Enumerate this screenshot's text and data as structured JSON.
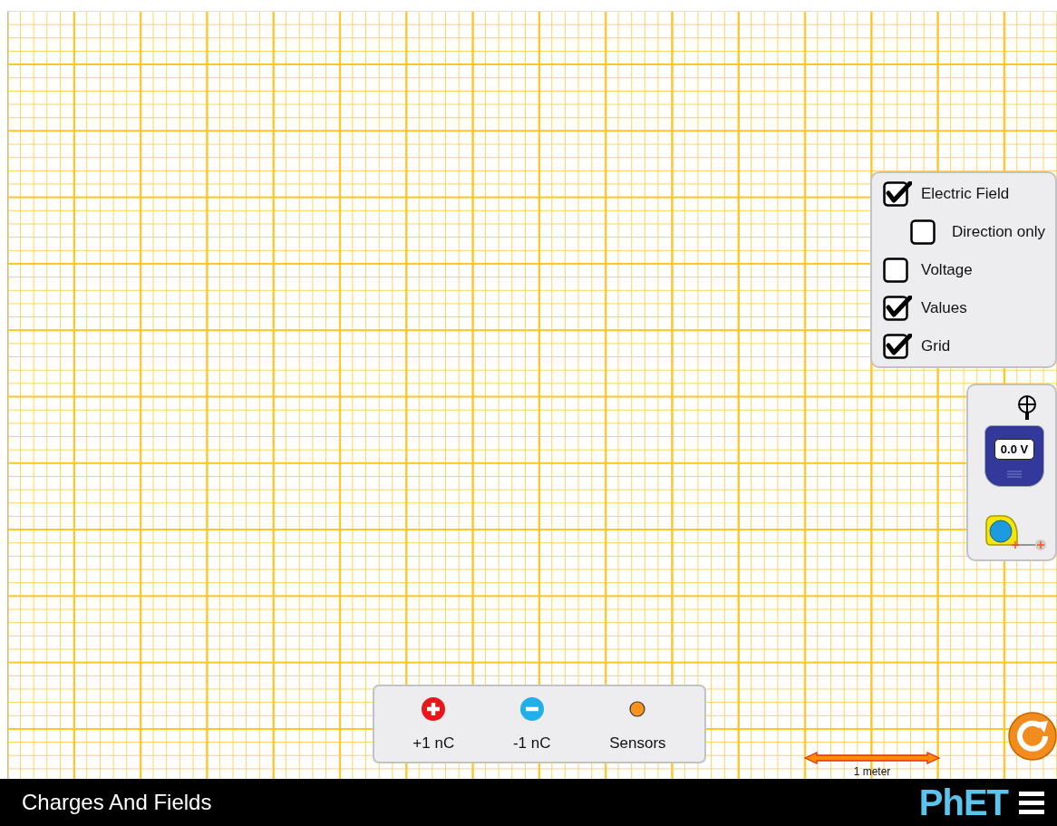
{
  "controls": [
    {
      "label": "Electric Field",
      "checked": true,
      "children": [
        {
          "label": "Direction only",
          "checked": false
        }
      ]
    },
    {
      "label": "Voltage",
      "checked": false
    },
    {
      "label": "Values",
      "checked": true
    },
    {
      "label": "Grid",
      "checked": true
    }
  ],
  "voltmeter": {
    "reading": "0.0 V"
  },
  "toolbox": [
    {
      "kind": "positive",
      "label": "+1 nC"
    },
    {
      "kind": "negative",
      "label": "-1 nC"
    },
    {
      "kind": "sensor",
      "label": "Sensors"
    }
  ],
  "scale": {
    "label": "1 meter"
  },
  "nav": {
    "title": "Charges And Fields",
    "logo": "PhET"
  }
}
